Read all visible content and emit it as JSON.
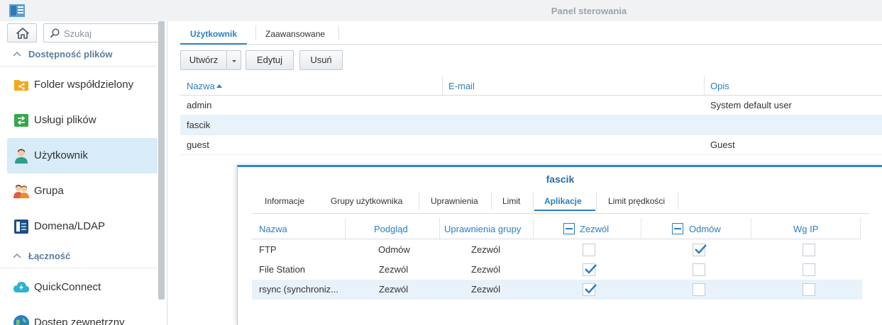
{
  "window": {
    "title": "Panel sterowania",
    "app_icon": "control-panel-icon"
  },
  "sidebar": {
    "search_placeholder": "Szukaj",
    "sections": [
      {
        "label": "Dostępność plików"
      },
      {
        "label": "Łączność"
      }
    ],
    "items": [
      {
        "label": "Folder współdzielony",
        "icon": "shared-folder-icon"
      },
      {
        "label": "Usługi plików",
        "icon": "file-services-icon"
      },
      {
        "label": "Użytkownik",
        "icon": "user-icon",
        "active": true
      },
      {
        "label": "Grupa",
        "icon": "group-icon"
      },
      {
        "label": "Domena/LDAP",
        "icon": "domain-icon"
      },
      {
        "label": "QuickConnect",
        "icon": "quickconnect-icon"
      },
      {
        "label": "Dostęp zewnętrzny",
        "icon": "external-access-icon"
      }
    ]
  },
  "main": {
    "tabs": [
      {
        "label": "Użytkownik",
        "active": true
      },
      {
        "label": "Zaawansowane"
      }
    ],
    "toolbar": {
      "create": "Utwórz",
      "edit": "Edytuj",
      "delete": "Usuń"
    },
    "table": {
      "columns": [
        "Nazwa",
        "E-mail",
        "Opis"
      ],
      "rows": [
        {
          "name": "admin",
          "email": "",
          "desc": "System default user"
        },
        {
          "name": "fascik",
          "email": "",
          "desc": "",
          "selected": true
        },
        {
          "name": "guest",
          "email": "",
          "desc": "Guest"
        }
      ]
    }
  },
  "dialog": {
    "title": "fascik",
    "tabs": [
      "Informacje",
      "Grupy użytkownika",
      "Uprawnienia",
      "Limit",
      "Aplikacje",
      "Limit prędkości"
    ],
    "active_tab": "Aplikacje",
    "columns": [
      "Nazwa",
      "Podgląd",
      "Uprawnienia grupy",
      "Zezwól",
      "Odmów",
      "Wg IP"
    ],
    "rows": [
      {
        "name": "FTP",
        "preview": "Odmów",
        "group": "Zezwól",
        "allow": false,
        "deny": true,
        "byip": false
      },
      {
        "name": "File Station",
        "preview": "Zezwól",
        "group": "Zezwól",
        "allow": true,
        "deny": false,
        "byip": false
      },
      {
        "name": "rsync (synchroniz...",
        "preview": "Zezwól",
        "group": "Zezwól",
        "allow": true,
        "deny": false,
        "byip": false,
        "selected": true
      }
    ]
  },
  "colors": {
    "accent": "#2a7fc1",
    "selection": "#e8f2fb",
    "sidebar_active": "#d7ebf8",
    "dialog_border": "#2d87cf"
  }
}
